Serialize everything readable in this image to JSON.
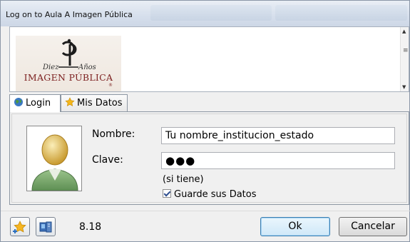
{
  "window": {
    "title": "Log on to Aula A Imagen Pública"
  },
  "logo": {
    "text": "Imagen Pública",
    "signature_left": "Diez",
    "signature_right": "Años"
  },
  "tabs": [
    {
      "label": "Login",
      "icon": "globe-icon",
      "active": true
    },
    {
      "label": "Mis Datos",
      "icon": "star-icon",
      "active": false
    }
  ],
  "form": {
    "name_label": "Nombre:",
    "name_value": "Tu nombre_institucion_estado",
    "password_label": "Clave:",
    "password_value": "●●●",
    "hint": "(si tiene)",
    "remember_label": "Guarde sus Datos",
    "remember_checked": true
  },
  "footer": {
    "version": "8.18",
    "ok_label": "Ok",
    "cancel_label": "Cancelar",
    "left_icons": [
      "star-add-icon",
      "computer-icon"
    ]
  },
  "colors": {
    "accent": "#3c7fb1",
    "logo_red": "#7c1f1f"
  }
}
